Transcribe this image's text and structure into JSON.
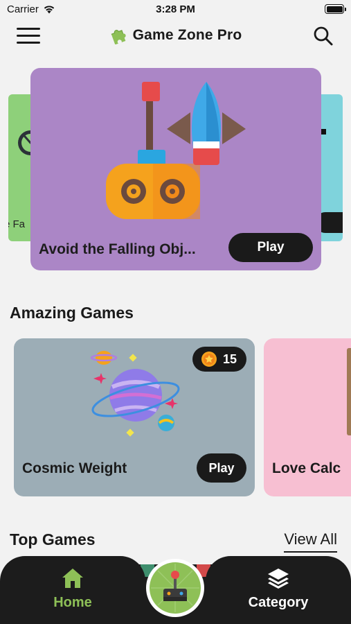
{
  "status_bar": {
    "carrier": "Carrier",
    "time": "3:28 PM"
  },
  "header": {
    "title": "Game Zone Pro"
  },
  "featured": {
    "left_fragment": "e Fa",
    "main_title": "Avoid the Falling Obj...",
    "play_label": "Play"
  },
  "amazing": {
    "title": "Amazing Games",
    "games": [
      {
        "name": "Cosmic Weight",
        "coins": "15",
        "play_label": "Play"
      },
      {
        "name": "Love Calc"
      }
    ]
  },
  "top": {
    "title": "Top Games",
    "view_all": "View All"
  },
  "tabbar": {
    "home": "Home",
    "category": "Category"
  },
  "colors": {
    "featured_bg": "#ab86c6",
    "cosmic_bg": "#9cadb6",
    "love_bg": "#f7bfd2",
    "accent_green": "#8ec057",
    "dark": "#1c1c1c"
  },
  "icons": [
    "wifi-icon",
    "battery-icon",
    "hamburger-menu-icon",
    "puzzle-icon",
    "search-icon",
    "coin-icon",
    "home-icon",
    "layers-icon",
    "joystick-icon"
  ]
}
